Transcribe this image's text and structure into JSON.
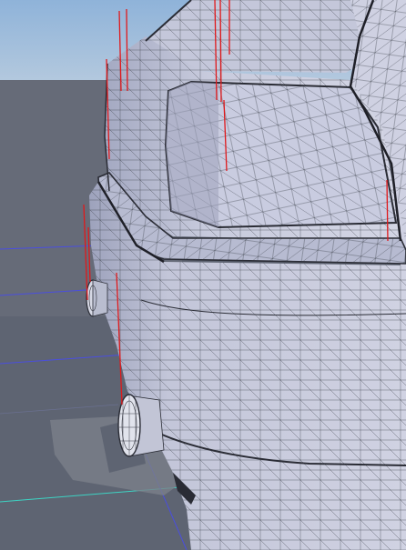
{
  "viewport": {
    "name": "3D viewport",
    "colors": {
      "sky": "#8fb3d9",
      "sky_low": "#b9cde0",
      "ground": "#5e6472",
      "ground_far": "#6d727d",
      "shadow": "#7d828b",
      "mesh_fill": "#c5c9dc",
      "mesh_fill_dark": "#a8adc4",
      "mesh_fill_light": "#d9dbe8",
      "wire": "#3a3d48",
      "normals": "#e0191b",
      "grid_blue": "#4a4ee0",
      "grid_cyan": "#3dd4c4"
    },
    "icons": [
      "normal-indicator-icon",
      "exhaust-pipe-icon"
    ]
  }
}
